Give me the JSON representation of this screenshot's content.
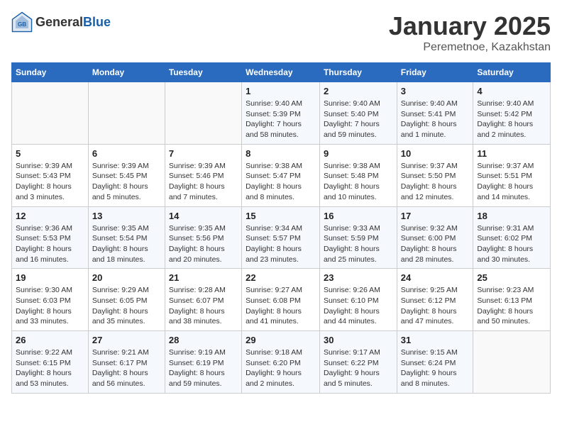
{
  "header": {
    "logo_general": "General",
    "logo_blue": "Blue",
    "title": "January 2025",
    "subtitle": "Peremetnoe, Kazakhstan"
  },
  "weekdays": [
    "Sunday",
    "Monday",
    "Tuesday",
    "Wednesday",
    "Thursday",
    "Friday",
    "Saturday"
  ],
  "weeks": [
    [
      {
        "day": "",
        "info": ""
      },
      {
        "day": "",
        "info": ""
      },
      {
        "day": "",
        "info": ""
      },
      {
        "day": "1",
        "info": "Sunrise: 9:40 AM\nSunset: 5:39 PM\nDaylight: 7 hours\nand 58 minutes."
      },
      {
        "day": "2",
        "info": "Sunrise: 9:40 AM\nSunset: 5:40 PM\nDaylight: 7 hours\nand 59 minutes."
      },
      {
        "day": "3",
        "info": "Sunrise: 9:40 AM\nSunset: 5:41 PM\nDaylight: 8 hours\nand 1 minute."
      },
      {
        "day": "4",
        "info": "Sunrise: 9:40 AM\nSunset: 5:42 PM\nDaylight: 8 hours\nand 2 minutes."
      }
    ],
    [
      {
        "day": "5",
        "info": "Sunrise: 9:39 AM\nSunset: 5:43 PM\nDaylight: 8 hours\nand 3 minutes."
      },
      {
        "day": "6",
        "info": "Sunrise: 9:39 AM\nSunset: 5:45 PM\nDaylight: 8 hours\nand 5 minutes."
      },
      {
        "day": "7",
        "info": "Sunrise: 9:39 AM\nSunset: 5:46 PM\nDaylight: 8 hours\nand 7 minutes."
      },
      {
        "day": "8",
        "info": "Sunrise: 9:38 AM\nSunset: 5:47 PM\nDaylight: 8 hours\nand 8 minutes."
      },
      {
        "day": "9",
        "info": "Sunrise: 9:38 AM\nSunset: 5:48 PM\nDaylight: 8 hours\nand 10 minutes."
      },
      {
        "day": "10",
        "info": "Sunrise: 9:37 AM\nSunset: 5:50 PM\nDaylight: 8 hours\nand 12 minutes."
      },
      {
        "day": "11",
        "info": "Sunrise: 9:37 AM\nSunset: 5:51 PM\nDaylight: 8 hours\nand 14 minutes."
      }
    ],
    [
      {
        "day": "12",
        "info": "Sunrise: 9:36 AM\nSunset: 5:53 PM\nDaylight: 8 hours\nand 16 minutes."
      },
      {
        "day": "13",
        "info": "Sunrise: 9:35 AM\nSunset: 5:54 PM\nDaylight: 8 hours\nand 18 minutes."
      },
      {
        "day": "14",
        "info": "Sunrise: 9:35 AM\nSunset: 5:56 PM\nDaylight: 8 hours\nand 20 minutes."
      },
      {
        "day": "15",
        "info": "Sunrise: 9:34 AM\nSunset: 5:57 PM\nDaylight: 8 hours\nand 23 minutes."
      },
      {
        "day": "16",
        "info": "Sunrise: 9:33 AM\nSunset: 5:59 PM\nDaylight: 8 hours\nand 25 minutes."
      },
      {
        "day": "17",
        "info": "Sunrise: 9:32 AM\nSunset: 6:00 PM\nDaylight: 8 hours\nand 28 minutes."
      },
      {
        "day": "18",
        "info": "Sunrise: 9:31 AM\nSunset: 6:02 PM\nDaylight: 8 hours\nand 30 minutes."
      }
    ],
    [
      {
        "day": "19",
        "info": "Sunrise: 9:30 AM\nSunset: 6:03 PM\nDaylight: 8 hours\nand 33 minutes."
      },
      {
        "day": "20",
        "info": "Sunrise: 9:29 AM\nSunset: 6:05 PM\nDaylight: 8 hours\nand 35 minutes."
      },
      {
        "day": "21",
        "info": "Sunrise: 9:28 AM\nSunset: 6:07 PM\nDaylight: 8 hours\nand 38 minutes."
      },
      {
        "day": "22",
        "info": "Sunrise: 9:27 AM\nSunset: 6:08 PM\nDaylight: 8 hours\nand 41 minutes."
      },
      {
        "day": "23",
        "info": "Sunrise: 9:26 AM\nSunset: 6:10 PM\nDaylight: 8 hours\nand 44 minutes."
      },
      {
        "day": "24",
        "info": "Sunrise: 9:25 AM\nSunset: 6:12 PM\nDaylight: 8 hours\nand 47 minutes."
      },
      {
        "day": "25",
        "info": "Sunrise: 9:23 AM\nSunset: 6:13 PM\nDaylight: 8 hours\nand 50 minutes."
      }
    ],
    [
      {
        "day": "26",
        "info": "Sunrise: 9:22 AM\nSunset: 6:15 PM\nDaylight: 8 hours\nand 53 minutes."
      },
      {
        "day": "27",
        "info": "Sunrise: 9:21 AM\nSunset: 6:17 PM\nDaylight: 8 hours\nand 56 minutes."
      },
      {
        "day": "28",
        "info": "Sunrise: 9:19 AM\nSunset: 6:19 PM\nDaylight: 8 hours\nand 59 minutes."
      },
      {
        "day": "29",
        "info": "Sunrise: 9:18 AM\nSunset: 6:20 PM\nDaylight: 9 hours\nand 2 minutes."
      },
      {
        "day": "30",
        "info": "Sunrise: 9:17 AM\nSunset: 6:22 PM\nDaylight: 9 hours\nand 5 minutes."
      },
      {
        "day": "31",
        "info": "Sunrise: 9:15 AM\nSunset: 6:24 PM\nDaylight: 9 hours\nand 8 minutes."
      },
      {
        "day": "",
        "info": ""
      }
    ]
  ]
}
